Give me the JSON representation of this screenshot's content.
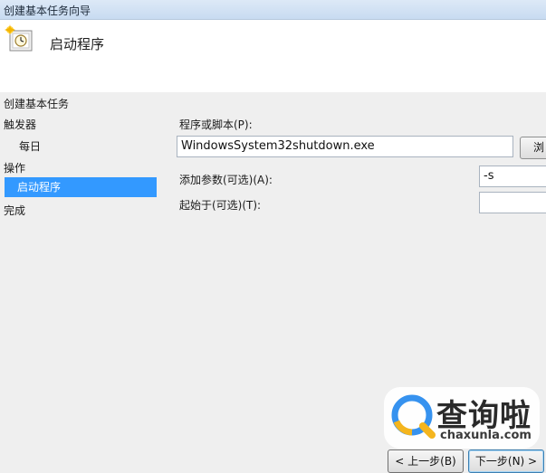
{
  "window": {
    "title": "创建基本任务向导"
  },
  "header": {
    "title": "启动程序",
    "icon": "scheduled-task-clock-icon"
  },
  "sidebar": {
    "items": [
      {
        "label": "创建基本任务"
      },
      {
        "label": "触发器"
      },
      {
        "label": "每日"
      },
      {
        "label": "操作"
      },
      {
        "label": "启动程序",
        "selected": true
      },
      {
        "label": "完成"
      }
    ]
  },
  "form": {
    "program_label": "程序或脚本(P):",
    "program_value": "WindowsSystem32shutdown.exe",
    "browse_label": "浏",
    "args_label": "添加参数(可选)(A):",
    "args_value": "-s",
    "start_label": "起始于(可选)(T):",
    "start_value": ""
  },
  "footer": {
    "back_label": "< 上一步(B)",
    "next_label": "下一步(N) >"
  },
  "watermark": {
    "name": "查询啦",
    "domain": "chaxunla.com"
  },
  "colors": {
    "selection": "#3399ff",
    "titlebar": "#c8dbf1",
    "panel": "#efefef"
  }
}
